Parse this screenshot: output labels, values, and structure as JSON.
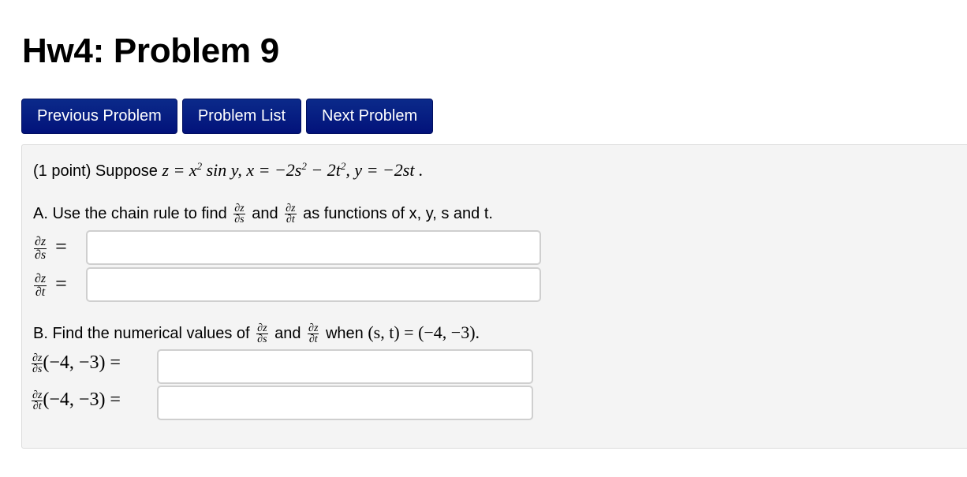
{
  "page": {
    "title": "Hw4: Problem 9"
  },
  "nav": {
    "previous_label": "Previous Problem",
    "list_label": "Problem List",
    "next_label": "Next Problem",
    "button_color": "#02127a"
  },
  "problem": {
    "points": "(1 point) Suppose",
    "z_def": "z = x",
    "z_exp": "2",
    "z_tail": " sin y, x = −2s",
    "x_exp1": "2",
    "x_mid": " − 2t",
    "x_exp2": "2",
    "y_def": ", y = −2st .",
    "partA": {
      "prefix": "A. Use the chain rule to find",
      "and": "and",
      "suffix": "as functions of x, y, s and t.",
      "dz": "∂z",
      "ds": "∂s",
      "dt": "∂t",
      "equals": "=",
      "answer_ds": "",
      "answer_dt": ""
    },
    "partB": {
      "prefix": "B. Find the numerical values of",
      "and": "and",
      "when": "when",
      "point_expr": "(s, t) = (−4, −3).",
      "eval_point": "(−4, −3) =",
      "dz": "∂z",
      "ds": "∂s",
      "dt": "∂t",
      "answer_ds": "",
      "answer_dt": ""
    }
  }
}
